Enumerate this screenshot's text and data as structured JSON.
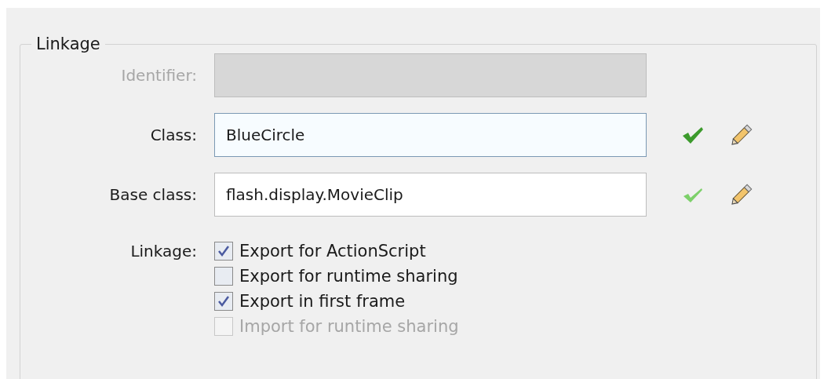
{
  "group": {
    "title": "Linkage"
  },
  "fields": [
    {
      "label": "Identifier:",
      "disabled": true,
      "focused": false,
      "validated": false
    },
    {
      "label": "Class:",
      "value": "BlueCircle",
      "disabled": false,
      "focused": true,
      "validated": true
    },
    {
      "label": "Base class:",
      "value": "flash.display.MovieClip",
      "disabled": false,
      "focused": false,
      "validated": true
    }
  ],
  "options": {
    "label": "Linkage:",
    "items": [
      {
        "label": "Export for ActionScript",
        "checked": true,
        "disabled": false
      },
      {
        "label": "Export for runtime sharing",
        "checked": false,
        "disabled": false
      },
      {
        "label": "Export in first frame",
        "checked": true,
        "disabled": false
      },
      {
        "label": "Import for runtime sharing",
        "checked": false,
        "disabled": true
      }
    ]
  }
}
